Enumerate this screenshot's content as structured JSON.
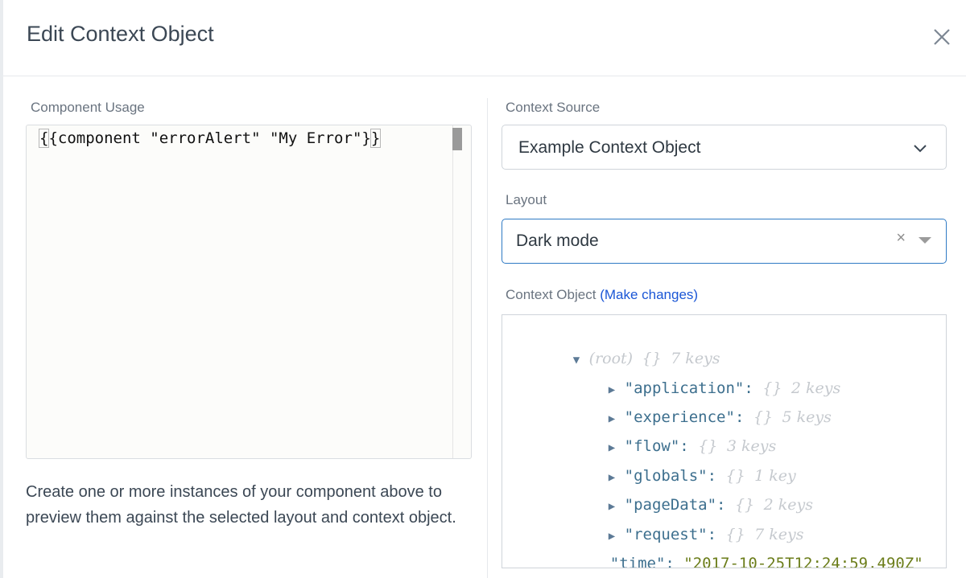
{
  "dialog": {
    "title": "Edit Context Object"
  },
  "usage": {
    "label": "Component Usage",
    "code_open": "{",
    "code_middle": "{component \"errorAlert\" \"My Error\"}",
    "code_close": "}",
    "help": "Create one or more instances of your component above to preview them against the selected layout and context object."
  },
  "source": {
    "label": "Context Source",
    "value": "Example Context Object"
  },
  "layout": {
    "label": "Layout",
    "value": "Dark mode"
  },
  "context": {
    "label": "Context Object",
    "link": "(Make changes)",
    "root": {
      "key": "(root)",
      "braces": "{}",
      "count": "7 keys"
    },
    "items": [
      {
        "key": "\"application\"",
        "braces": "{}",
        "count": "2 keys"
      },
      {
        "key": "\"experience\"",
        "braces": "{}",
        "count": "5 keys"
      },
      {
        "key": "\"flow\"",
        "braces": "{}",
        "count": "3 keys"
      },
      {
        "key": "\"globals\"",
        "braces": "{}",
        "count": "1 key"
      },
      {
        "key": "\"pageData\"",
        "braces": "{}",
        "count": "2 keys"
      },
      {
        "key": "\"request\"",
        "braces": "{}",
        "count": "7 keys"
      }
    ],
    "time": {
      "key": "\"time\"",
      "value": "\"2017-10-25T12:24:59.490Z\""
    }
  },
  "icons": {
    "close": "close-icon",
    "chevron": "chevron-down-icon",
    "clear": "×",
    "caret": "caret-down-icon",
    "expanded": "▼",
    "collapsed": "▶"
  },
  "colors": {
    "link": "#1a56d6",
    "focus_border": "#2f7ac4",
    "json_key": "#3d6f8e",
    "json_string": "#6b7d1a"
  }
}
